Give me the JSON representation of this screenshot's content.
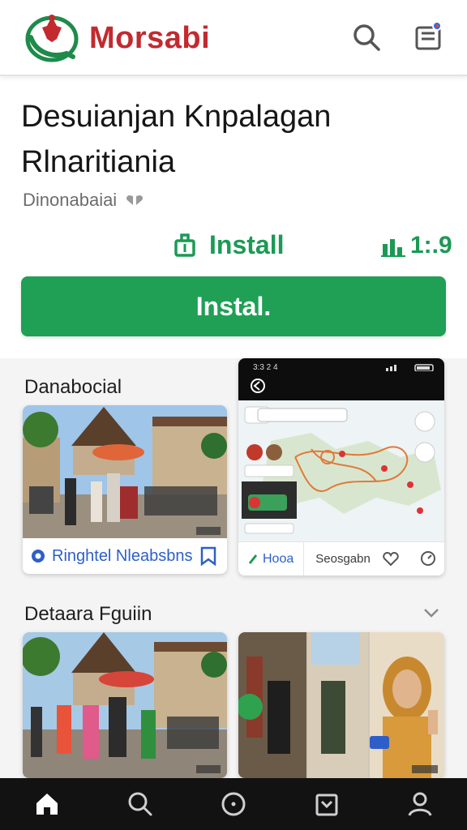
{
  "header": {
    "brand": "Morsabi",
    "icons": [
      "logo-emblem-icon",
      "search-icon",
      "inbox-icon"
    ],
    "brand_color": "#c22a2f"
  },
  "app": {
    "title": "Desuianjan Knpalagan Rlnaritiania",
    "subtitle": "Dinonabaiai",
    "install_link_label": "Install",
    "rating_value": "1:.9",
    "install_button_label": "Instal.",
    "accent_color": "#1fa055"
  },
  "feed": {
    "section1_title": "Danabocial",
    "card1_label": "Ringhtel Nleabsbns",
    "card2": {
      "status_time": "3:3 2 4",
      "tab_a_label": "Hooa",
      "tab_b_label": "Seosgabn"
    },
    "section2_title": "Detaara Fguiin"
  },
  "bottom_nav": {
    "items": [
      "home-icon",
      "search-icon",
      "circle-icon",
      "calendar-icon",
      "profile-icon"
    ]
  }
}
